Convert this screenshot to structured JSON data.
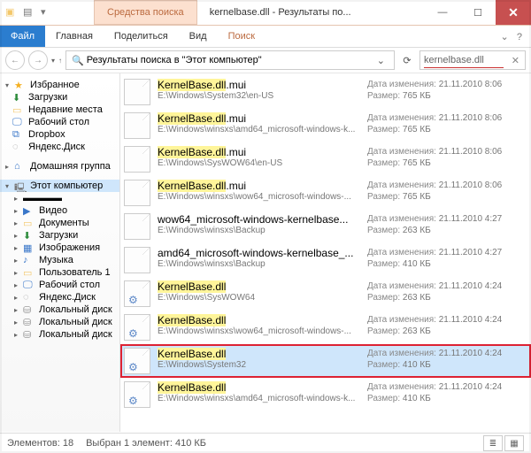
{
  "titlebar": {
    "tool_tab": "Средства поиска",
    "title": "kernelbase.dll - Результаты по..."
  },
  "ribbon": {
    "file": "Файл",
    "home": "Главная",
    "share": "Поделиться",
    "view": "Вид",
    "search": "Поиск"
  },
  "addr": {
    "breadcrumb": "Результаты поиска в \"Этот компьютер\""
  },
  "search": {
    "value": "kernelbase.dll"
  },
  "nav": {
    "fav_head": "Избранное",
    "fav": [
      "Загрузки",
      "Недавние места",
      "Рабочий стол",
      "Dropbox",
      "Яндекс.Диск"
    ],
    "homegroup": "Домашняя группа",
    "pc_head": "Этот компьютер",
    "pc": [
      "Видео",
      "Документы",
      "Загрузки",
      "Изображения",
      "Музыка",
      "Пользователь 1",
      "Рабочий стол",
      "Яндекс.Диск",
      "Локальный диск",
      "Локальный диск",
      "Локальный диск"
    ]
  },
  "meta_labels": {
    "date": "Дата изменения:",
    "size": "Размер:"
  },
  "files": [
    {
      "name": "KernelBase.dll.mui",
      "path": "E:\\Windows\\System32\\en-US",
      "date": "21.11.2010 8:06",
      "size": "765 КБ",
      "hl": true,
      "gear": false,
      "red": false
    },
    {
      "name": "KernelBase.dll.mui",
      "path": "E:\\Windows\\winsxs\\amd64_microsoft-windows-k...",
      "date": "21.11.2010 8:06",
      "size": "765 КБ",
      "hl": true,
      "gear": false,
      "red": false
    },
    {
      "name": "KernelBase.dll.mui",
      "path": "E:\\Windows\\SysWOW64\\en-US",
      "date": "21.11.2010 8:06",
      "size": "765 КБ",
      "hl": true,
      "gear": false,
      "red": false
    },
    {
      "name": "KernelBase.dll.mui",
      "path": "E:\\Windows\\winsxs\\wow64_microsoft-windows-...",
      "date": "21.11.2010 8:06",
      "size": "765 КБ",
      "hl": true,
      "gear": false,
      "red": false
    },
    {
      "name": "wow64_microsoft-windows-kernelbase...",
      "path": "E:\\Windows\\winsxs\\Backup",
      "date": "21.11.2010 4:27",
      "size": "263 КБ",
      "hl": false,
      "gear": false,
      "red": false
    },
    {
      "name": "amd64_microsoft-windows-kernelbase_...",
      "path": "E:\\Windows\\winsxs\\Backup",
      "date": "21.11.2010 4:27",
      "size": "410 КБ",
      "hl": false,
      "gear": false,
      "red": false
    },
    {
      "name": "KernelBase.dll",
      "path": "E:\\Windows\\SysWOW64",
      "date": "21.11.2010 4:24",
      "size": "263 КБ",
      "hl": true,
      "gear": true,
      "red": false
    },
    {
      "name": "KernelBase.dll",
      "path": "E:\\Windows\\winsxs\\wow64_microsoft-windows-...",
      "date": "21.11.2010 4:24",
      "size": "263 КБ",
      "hl": true,
      "gear": true,
      "red": false
    },
    {
      "name": "KernelBase.dll",
      "path": "E:\\Windows\\System32",
      "date": "21.11.2010 4:24",
      "size": "410 КБ",
      "hl": true,
      "gear": true,
      "red": true
    },
    {
      "name": "KernelBase.dll",
      "path": "E:\\Windows\\winsxs\\amd64_microsoft-windows-k...",
      "date": "21.11.2010 4:24",
      "size": "410 КБ",
      "hl": true,
      "gear": true,
      "red": false
    }
  ],
  "status": {
    "count": "Элементов: 18",
    "sel": "Выбран 1 элемент: 410 КБ"
  }
}
